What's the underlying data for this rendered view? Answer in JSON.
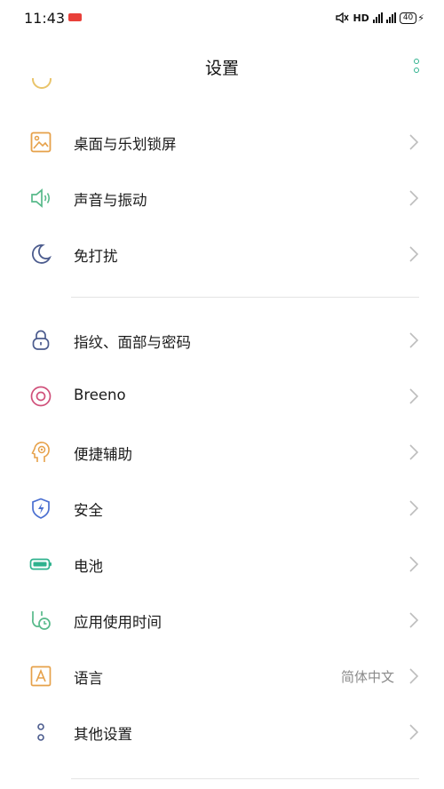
{
  "status_bar": {
    "time": "11:43",
    "hd_label": "HD",
    "battery_level": "40"
  },
  "header": {
    "title": "设置"
  },
  "colors": {
    "accent": "#2fb28e",
    "chevron": "#bdbdbd",
    "divider": "#e4e4e4"
  },
  "settings": {
    "group1": [
      {
        "label": "桌面与乐划锁屏",
        "icon": "wallpaper-icon"
      },
      {
        "label": "声音与振动",
        "icon": "speaker-icon"
      },
      {
        "label": "免打扰",
        "icon": "moon-icon"
      }
    ],
    "group2": [
      {
        "label": "指纹、面部与密码",
        "icon": "lock-icon"
      },
      {
        "label": "Breeno",
        "icon": "breeno-icon"
      },
      {
        "label": "便捷辅助",
        "icon": "assist-head-icon"
      },
      {
        "label": "安全",
        "icon": "shield-icon"
      },
      {
        "label": "电池",
        "icon": "battery-icon"
      },
      {
        "label": "应用使用时间",
        "icon": "app-timer-icon"
      },
      {
        "label": "语言",
        "icon": "language-icon",
        "value": "简体中文"
      },
      {
        "label": "其他设置",
        "icon": "more-settings-icon"
      }
    ]
  }
}
